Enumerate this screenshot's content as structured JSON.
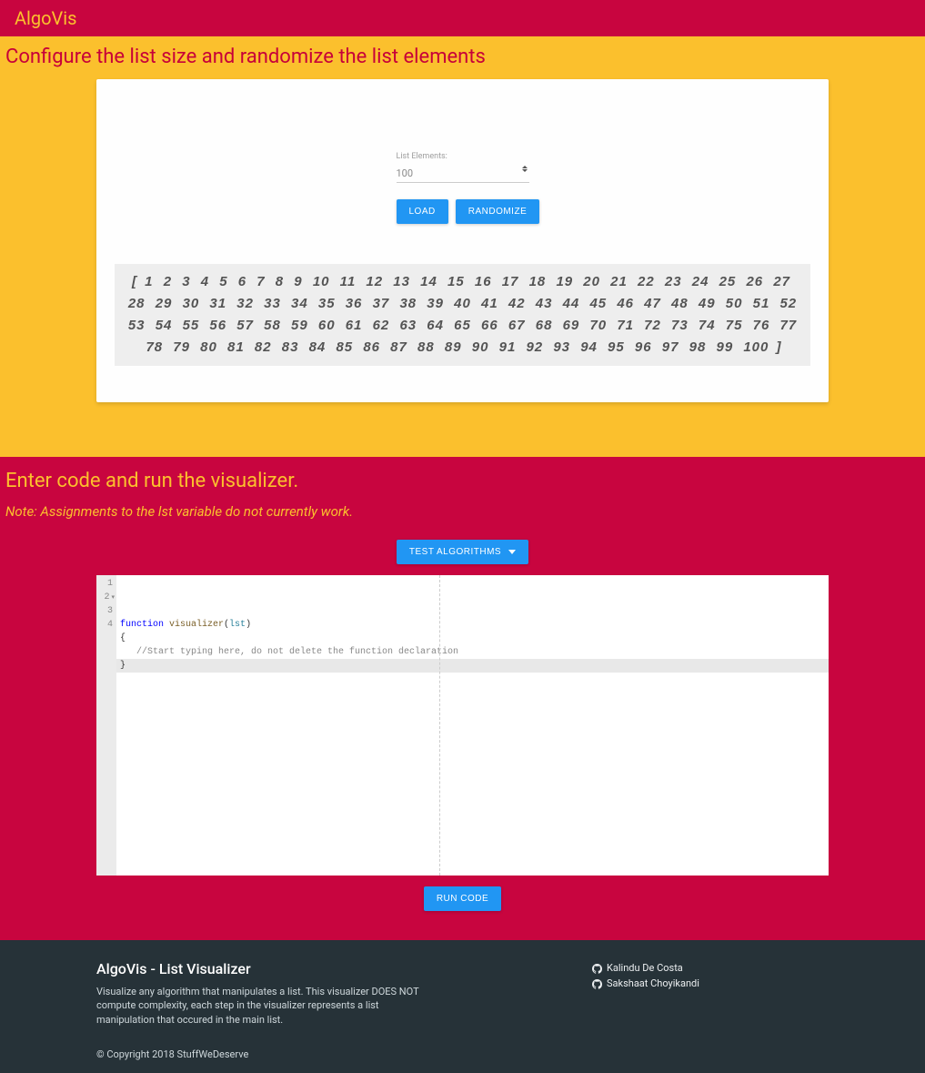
{
  "header": {
    "app_title": "AlgoVis"
  },
  "config": {
    "title": "Configure the list size and randomize the list elements",
    "list_elements_label": "List Elements:",
    "list_elements_value": "100",
    "load_btn": "LOAD",
    "randomize_btn": "RANDOMIZE",
    "list_values": [
      1,
      2,
      3,
      4,
      5,
      6,
      7,
      8,
      9,
      10,
      11,
      12,
      13,
      14,
      15,
      16,
      17,
      18,
      19,
      20,
      21,
      22,
      23,
      24,
      25,
      26,
      27,
      28,
      29,
      30,
      31,
      32,
      33,
      34,
      35,
      36,
      37,
      38,
      39,
      40,
      41,
      42,
      43,
      44,
      45,
      46,
      47,
      48,
      49,
      50,
      51,
      52,
      53,
      54,
      55,
      56,
      57,
      58,
      59,
      60,
      61,
      62,
      63,
      64,
      65,
      66,
      67,
      68,
      69,
      70,
      71,
      72,
      73,
      74,
      75,
      76,
      77,
      78,
      79,
      80,
      81,
      82,
      83,
      84,
      85,
      86,
      87,
      88,
      89,
      90,
      91,
      92,
      93,
      94,
      95,
      96,
      97,
      98,
      99,
      100
    ]
  },
  "code_section": {
    "title": "Enter code and run the visualizer.",
    "note": "Note: Assignments to the lst variable do not currently work.",
    "test_btn": "TEST ALGORITHMS",
    "run_btn": "RUN CODE",
    "lines": [
      {
        "n": "1",
        "kind": "sig",
        "kw": "function ",
        "fn": "visualizer",
        "open": "(",
        "param": "lst",
        "close": ")"
      },
      {
        "n": "2",
        "kind": "brace",
        "text": "{"
      },
      {
        "n": "3",
        "kind": "cmt",
        "text": "   //Start typing here, do not delete the function declaration"
      },
      {
        "n": "4",
        "kind": "brace_hl",
        "text": "}"
      }
    ]
  },
  "footer": {
    "title": "AlgoVis - List Visualizer",
    "desc": "Visualize any algorithm that manipulates a list. This visualizer DOES NOT compute complexity, each step in the visualizer represents a list manipulation that occured in the main list.",
    "contributors": [
      "Kalindu De Costa",
      "Sakshaat Choyikandi"
    ],
    "copyright": "© Copyright 2018 StuffWeDeserve"
  }
}
